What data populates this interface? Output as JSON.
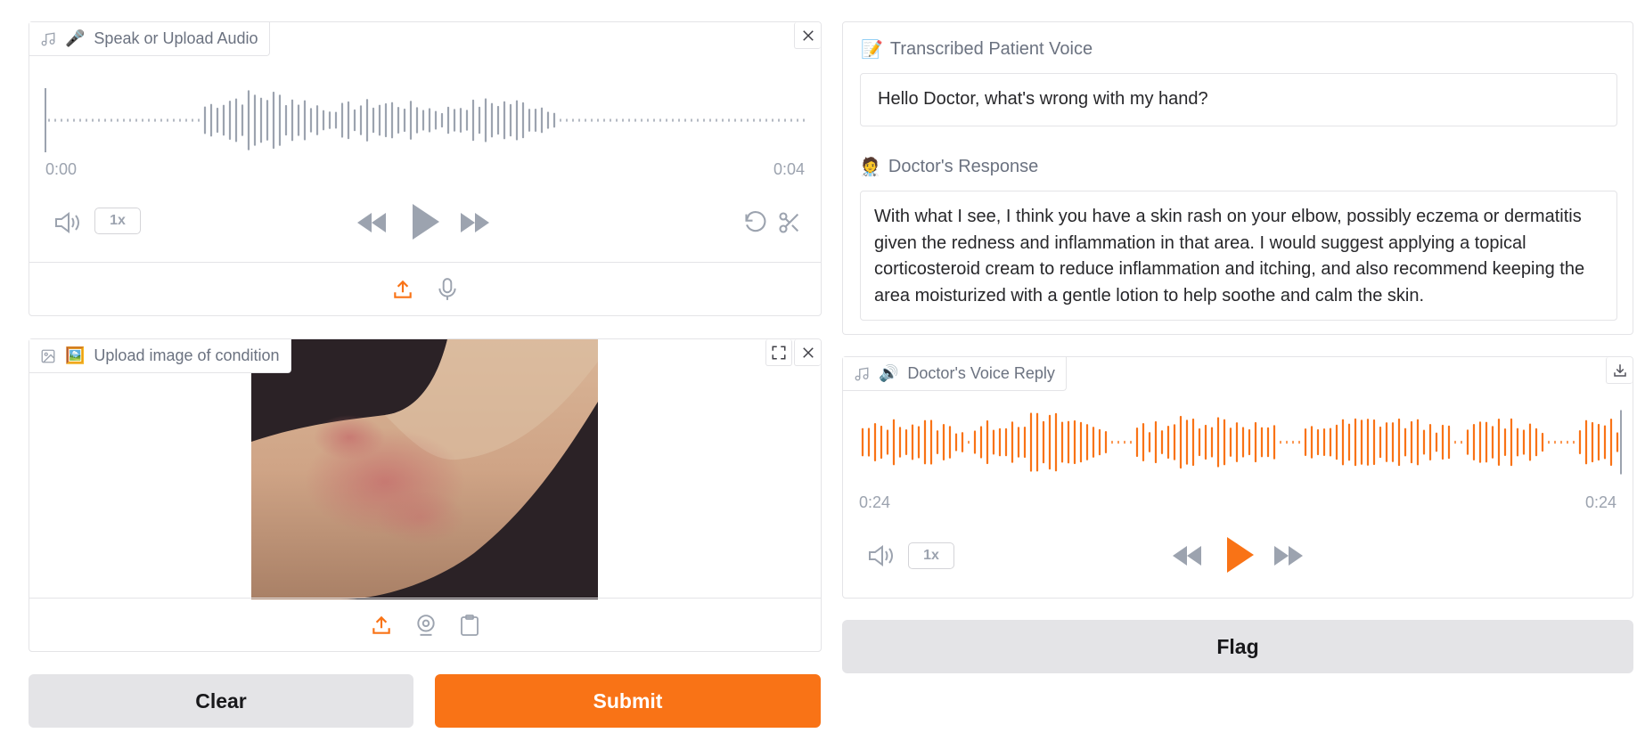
{
  "colors": {
    "accent": "#f97316",
    "wave_gray": "#9ca3af",
    "border": "#e4e4e7"
  },
  "audio_input": {
    "label": "Speak or Upload Audio",
    "label_emoji": "🎤",
    "label_icon": "music-note-icon",
    "time_start": "0:00",
    "time_end": "0:04",
    "rate": "1x",
    "sources": [
      "upload-icon",
      "microphone-icon"
    ]
  },
  "image_input": {
    "label": "Upload image of condition",
    "label_emoji": "🖼️",
    "label_icon": "image-icon",
    "sources": [
      "upload-icon",
      "webcam-icon",
      "clipboard-icon"
    ]
  },
  "transcription": {
    "label": "Transcribed Patient Voice",
    "label_emoji": "📝",
    "value": "Hello Doctor, what's wrong with my hand?"
  },
  "response": {
    "label": "Doctor's Response",
    "label_emoji": "🧑‍⚕️",
    "value": "With what I see, I think you have a skin rash on your elbow, possibly eczema or dermatitis given the redness and inflammation in that area. I would suggest applying a topical corticosteroid cream to reduce inflammation and itching, and also recommend keeping the area moisturized with a gentle lotion to help soothe and calm the skin."
  },
  "voice_reply": {
    "label": "Doctor's Voice Reply",
    "label_emoji": "🔊",
    "label_icon": "music-note-icon",
    "time_start": "0:24",
    "time_end": "0:24",
    "rate": "1x"
  },
  "buttons": {
    "clear": "Clear",
    "submit": "Submit",
    "flag": "Flag"
  }
}
